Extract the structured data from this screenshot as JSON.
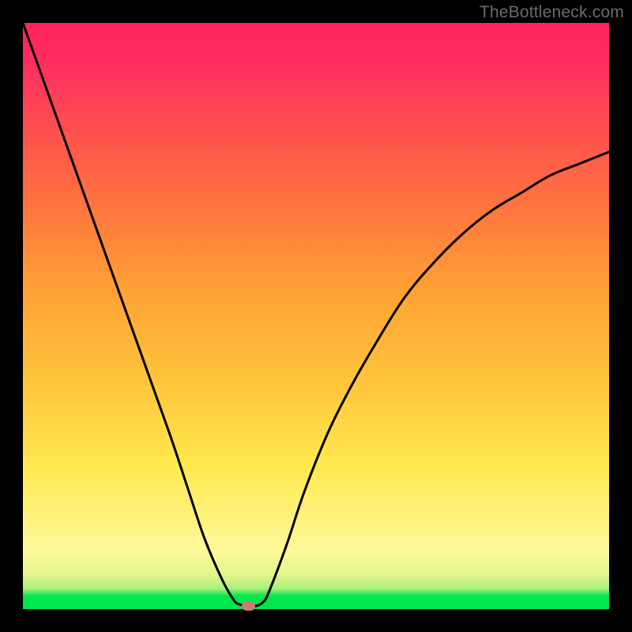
{
  "watermark": "TheBottleneck.com",
  "chart_data": {
    "type": "line",
    "title": "",
    "xlabel": "",
    "ylabel": "",
    "xlim": [
      0,
      100
    ],
    "ylim": [
      0,
      100
    ],
    "series": [
      {
        "name": "bottleneck-curve",
        "x": [
          0,
          5,
          10,
          15,
          20,
          25,
          28,
          31,
          34,
          36,
          37,
          38,
          39,
          40,
          41,
          42,
          45,
          48,
          52,
          56,
          60,
          65,
          70,
          75,
          80,
          85,
          90,
          95,
          100
        ],
        "values": [
          100,
          86,
          72,
          58,
          44,
          30,
          21,
          12,
          5,
          1.5,
          0.8,
          0.5,
          0.5,
          0.6,
          1.2,
          3,
          11,
          20,
          30,
          38,
          45,
          53,
          59,
          64,
          68,
          71,
          74,
          76,
          78
        ]
      }
    ],
    "marker": {
      "x": 38.5,
      "y": 0.5
    },
    "gradient_bands_pct_from_bottom": {
      "green_solid": [
        0,
        2.2
      ],
      "green_to_paleyellow": [
        2.2,
        10
      ],
      "yellow": [
        10,
        40
      ],
      "orange": [
        40,
        70
      ],
      "red_pink": [
        70,
        100
      ]
    }
  }
}
